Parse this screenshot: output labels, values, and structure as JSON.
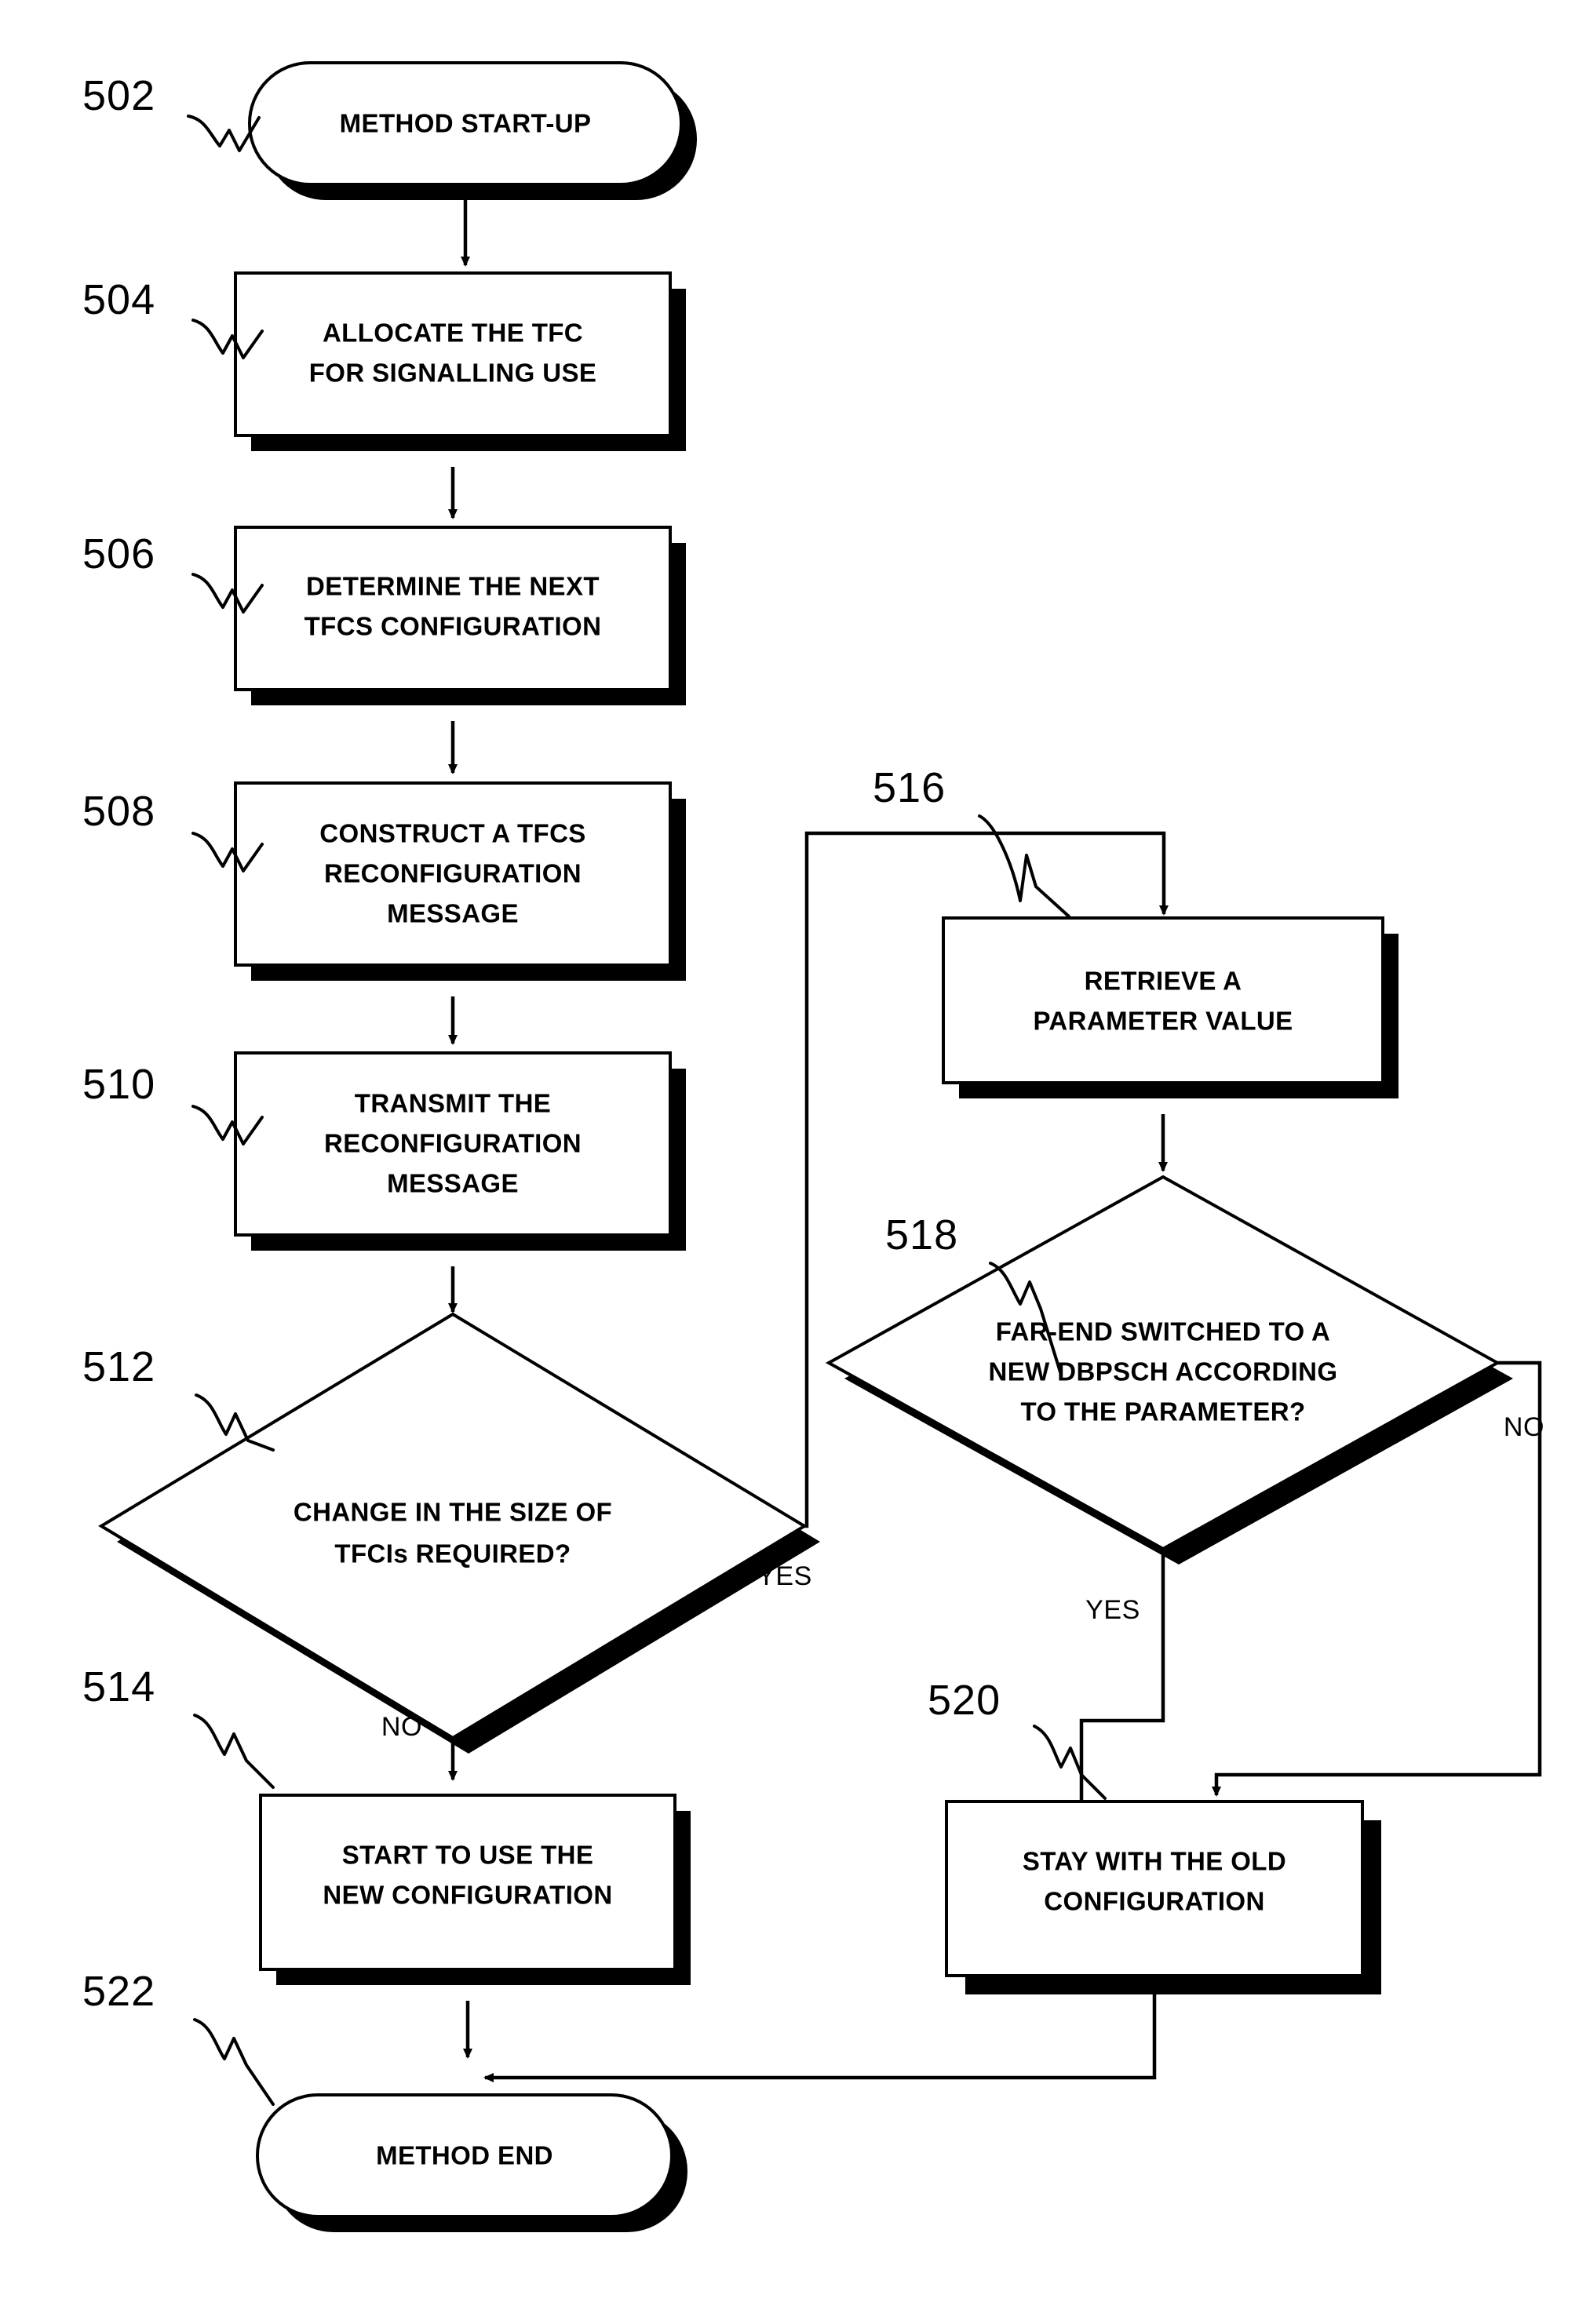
{
  "figure": {
    "type": "flowchart",
    "title": "Method flowchart for TFCS reconfiguration",
    "nodes": [
      {
        "ref": "502",
        "shape": "terminator",
        "lines": [
          "METHOD START-UP"
        ]
      },
      {
        "ref": "504",
        "shape": "process",
        "lines": [
          "ALLOCATE THE TFC",
          "FOR SIGNALLING USE"
        ]
      },
      {
        "ref": "506",
        "shape": "process",
        "lines": [
          "DETERMINE THE NEXT",
          "TFCS CONFIGURATION"
        ]
      },
      {
        "ref": "508",
        "shape": "process",
        "lines": [
          "CONSTRUCT A TFCS",
          "RECONFIGURATION",
          "MESSAGE"
        ]
      },
      {
        "ref": "510",
        "shape": "process",
        "lines": [
          "TRANSMIT THE",
          "RECONFIGURATION",
          "MESSAGE"
        ]
      },
      {
        "ref": "512",
        "shape": "decision",
        "lines": [
          "CHANGE IN THE SIZE OF",
          "TFCIs REQUIRED?"
        ]
      },
      {
        "ref": "514",
        "shape": "process",
        "lines": [
          "START TO USE THE",
          "NEW CONFIGURATION"
        ]
      },
      {
        "ref": "516",
        "shape": "process",
        "lines": [
          "RETRIEVE A",
          "PARAMETER VALUE"
        ]
      },
      {
        "ref": "518",
        "shape": "decision",
        "lines": [
          "FAR-END SWITCHED TO A",
          "NEW DBPSCH ACCORDING",
          "TO THE PARAMETER?"
        ]
      },
      {
        "ref": "520",
        "shape": "process",
        "lines": [
          "STAY WITH THE OLD",
          "CONFIGURATION"
        ]
      },
      {
        "ref": "522",
        "shape": "terminator",
        "lines": [
          "METHOD END"
        ]
      }
    ],
    "branch_labels": {
      "d512_yes": "YES",
      "d512_no": "NO",
      "d518_yes": "YES",
      "d518_no": "NO"
    },
    "colors": {
      "stroke": "#000000",
      "fill": "#ffffff",
      "shadow": "#000000"
    }
  }
}
